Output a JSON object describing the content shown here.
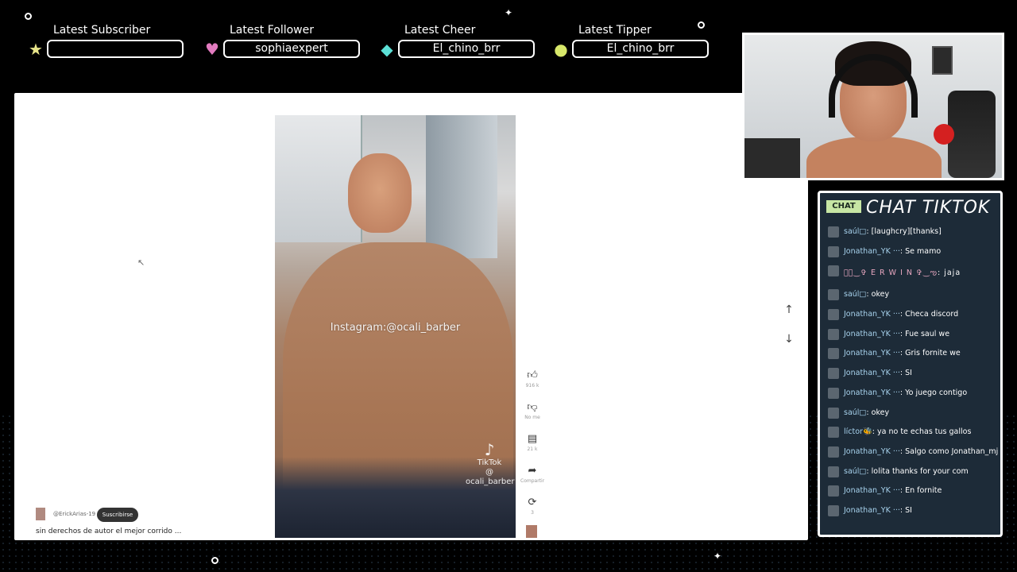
{
  "alerts": [
    {
      "title": "Latest Subscriber",
      "value": "",
      "icon": "star-icon",
      "glyph": "★",
      "color": "#e8e58a"
    },
    {
      "title": "Latest Follower",
      "value": "sophiaexpert",
      "icon": "heart-icon",
      "glyph": "♥",
      "color": "#e27bbf"
    },
    {
      "title": "Latest Cheer",
      "value": "El_chino_brr",
      "icon": "gem-icon",
      "glyph": "◆",
      "color": "#5ce0d6"
    },
    {
      "title": "Latest Tipper",
      "value": "El_chino_brr",
      "icon": "coin-icon",
      "glyph": "●",
      "color": "#d8e86a"
    }
  ],
  "video": {
    "watermark": "Instagram:@ocali_barber",
    "tiktok_logo": "TikTok",
    "tiktok_handle": "@ ocali_barber",
    "actions": [
      {
        "icon": "like-icon",
        "glyph": "👍︎",
        "count": "916 k"
      },
      {
        "icon": "dislike-icon",
        "glyph": "👎︎",
        "count": "No me"
      },
      {
        "icon": "comment-icon",
        "glyph": "▤",
        "count": "21 k"
      },
      {
        "icon": "share-icon",
        "glyph": "➦",
        "count": "Compartir"
      },
      {
        "icon": "remix-icon",
        "glyph": "⟳",
        "count": "3"
      }
    ],
    "author_handle": "@ErickArias-19",
    "subscribe_label": "Suscribirse",
    "caption": "sin derechos de autor el mejor corrido ..."
  },
  "nav": {
    "up": "↑",
    "down": "↓"
  },
  "chat": {
    "badge": "CHAT",
    "title": "CHAT TIKTOK",
    "messages": [
      {
        "user": "saúl□",
        "text": ": [laughcry][thanks]"
      },
      {
        "user": "Jonathan_YK ···",
        "text": ": Se mamo"
      },
      {
        "user": "ఌ⃝‿✞ E R W I N ✞‿ఌ",
        "text": ": jaja",
        "fancy": true
      },
      {
        "user": "saúl□",
        "text": ": okey"
      },
      {
        "user": "Jonathan_YK ···",
        "text": ": Checa discord"
      },
      {
        "user": "Jonathan_YK ···",
        "text": ": Fue saul we"
      },
      {
        "user": "Jonathan_YK ···",
        "text": ": Gris fornite we"
      },
      {
        "user": "Jonathan_YK ···",
        "text": ": SI"
      },
      {
        "user": "Jonathan_YK ···",
        "text": ": Yo juego contigo"
      },
      {
        "user": "saúl□",
        "text": ": okey"
      },
      {
        "user": "líctor🐝",
        "text": ": ya no te echas tus gallos"
      },
      {
        "user": "Jonathan_YK ···",
        "text": ": Salgo como Jonathan_mj"
      },
      {
        "user": "saúl□",
        "text": ": lolita thanks for your com"
      },
      {
        "user": "Jonathan_YK ···",
        "text": ": En fornite"
      },
      {
        "user": "Jonathan_YK ···",
        "text": ": SI"
      }
    ]
  }
}
